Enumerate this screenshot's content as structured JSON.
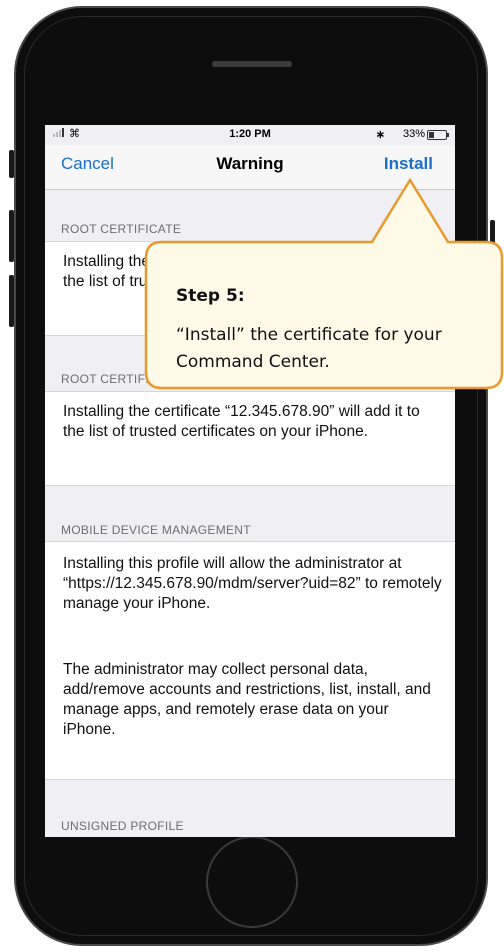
{
  "status_bar": {
    "time": "1:20 PM",
    "bluetooth_icon": "bluetooth-icon",
    "battery_percent": "33%",
    "battery_level": 0.33
  },
  "nav": {
    "cancel": "Cancel",
    "title": "Warning",
    "install": "Install"
  },
  "sections": [
    {
      "header": "ROOT CERTIFICATE",
      "body": "Installing the certificate “12.345.678.90” will add it to the list of trusted certificates on your iPhone."
    },
    {
      "header": "ROOT CERTIFICATE",
      "body": "Installing the certificate “12.345.678.90” will add it to the list of trusted certificates on your iPhone."
    },
    {
      "header": "MOBILE DEVICE MANAGEMENT",
      "body": "Installing this profile will allow the administrator at “https://12.345.678.90/mdm/server?uid=82” to remotely manage your iPhone.",
      "body2": "The administrator may collect personal data, add/remove accounts and restrictions, list, install, and manage apps, and remotely erase data on your iPhone."
    },
    {
      "header": "UNSIGNED PROFILE"
    }
  ],
  "callout": {
    "title": "Step 5:",
    "text": "“Install” the certificate for your Command Center.",
    "border_color": "#e89a2c",
    "fill_color": "#fff9e8"
  },
  "colors": {
    "accent": "#1a6fc9",
    "background": "#efeff4"
  }
}
